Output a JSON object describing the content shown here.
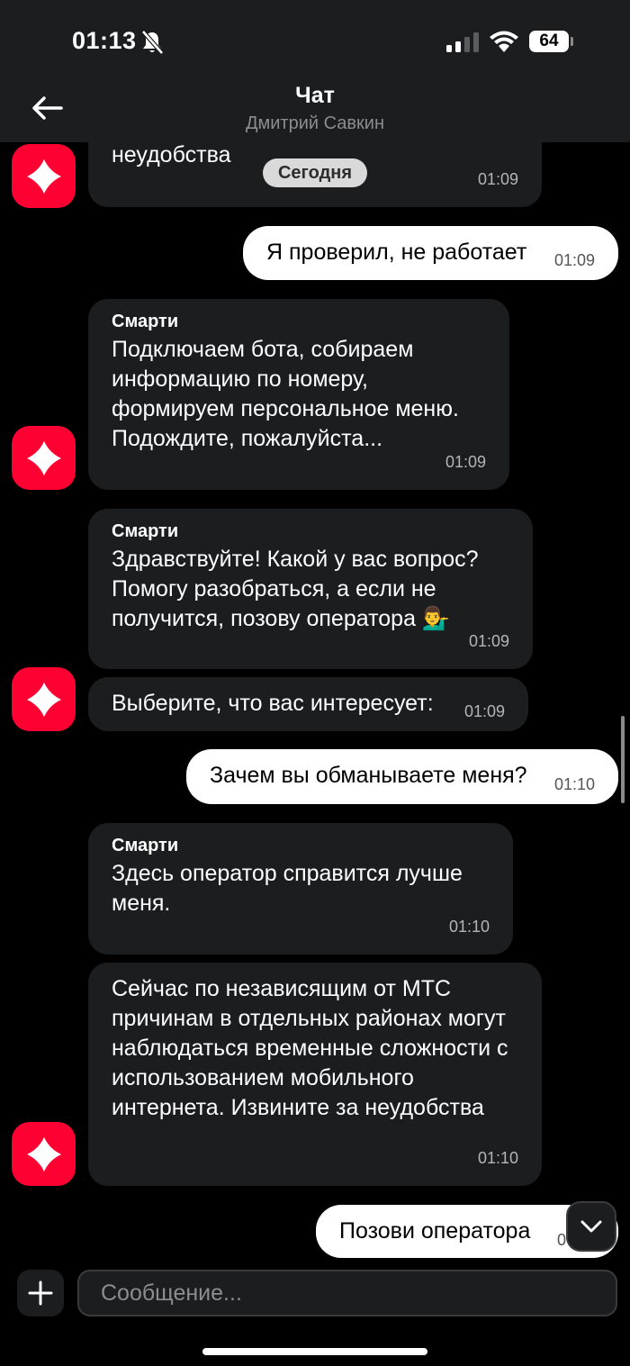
{
  "status_bar": {
    "time": "01:13",
    "battery": "64"
  },
  "header": {
    "title": "Чат",
    "subtitle": "Дмитрий Савкин"
  },
  "date_separator": "Сегодня",
  "messages": [
    {
      "text": "неудобства",
      "time": "01:09"
    },
    {
      "text": "Я проверил, не работает",
      "time": "01:09"
    },
    {
      "sender": "Смарти",
      "text": "Подключаем бота, собираем информацию по номеру, формируем персональное меню. Подождите, пожалуйста...",
      "time": "01:09"
    },
    {
      "sender": "Смарти",
      "text": "Здравствуйте! Какой у вас вопрос? Помогу разобраться, а если не получится, позову оператора 💁‍♂️",
      "time": "01:09"
    },
    {
      "text": "Выберите, что вас интересует:",
      "time": "01:09"
    },
    {
      "text": "Зачем вы обманываете меня?",
      "time": "01:10"
    },
    {
      "sender": "Смарти",
      "text": "Здесь оператор справится лучше меня.",
      "time": "01:10"
    },
    {
      "text": "Сейчас по независящим от МТС причинам в отдельных районах могут наблюдаться временные сложности с использованием мобильного интернета. Извините за неудобства",
      "time": "01:10"
    },
    {
      "text": "Позови оператора",
      "time": "0"
    }
  ],
  "composer": {
    "placeholder": "Сообщение..."
  },
  "icons": {
    "back": "arrow-left-icon",
    "attach": "plus-icon",
    "scroll_down": "chevron-down-icon",
    "avatar": "mts-star-icon",
    "status": [
      "bell-muted-icon",
      "cellular-signal-icon",
      "wifi-icon",
      "battery-icon"
    ]
  },
  "colors": {
    "avatar_bg": "#ff0032",
    "incoming_bubble": "#1c1d1f",
    "outgoing_bubble": "#ffffff",
    "background": "#000000"
  }
}
